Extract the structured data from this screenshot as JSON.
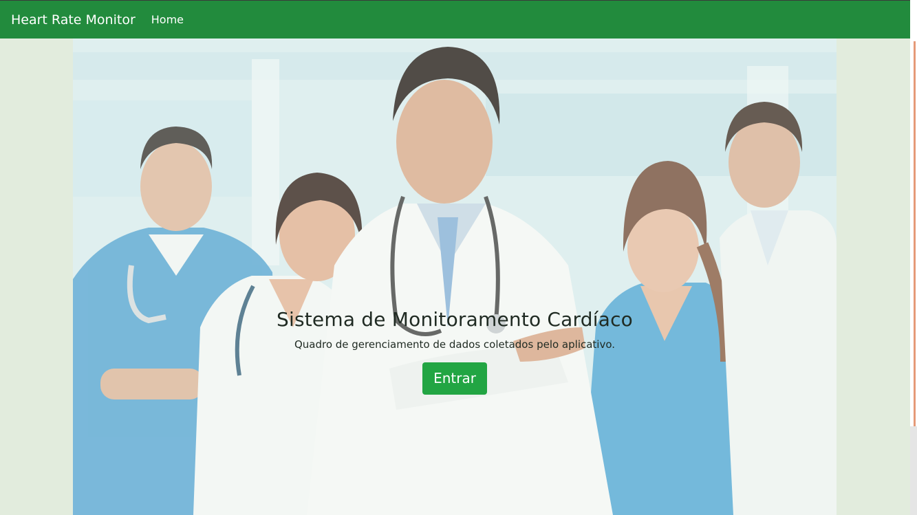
{
  "navbar": {
    "brand": "Heart Rate Monitor",
    "links": [
      {
        "label": "Home"
      }
    ]
  },
  "hero": {
    "title": "Sistema de Monitoramento Cardíaco",
    "subtitle": "Quadro de gerenciamento de dados coletados pelo aplicativo.",
    "button_label": "Entrar",
    "background_image": "medical-team-photo"
  },
  "colors": {
    "navbar": "#228b3d",
    "page_background": "#e2ecdd",
    "button": "#22a543",
    "text": "#1f2a22"
  }
}
